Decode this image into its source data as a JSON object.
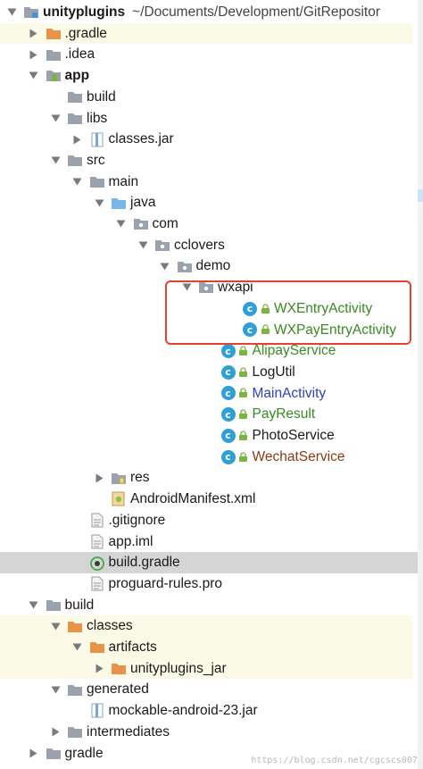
{
  "colors": {
    "green": "#3a8a22",
    "blue": "#2a45b8",
    "brown": "#8a3a14",
    "default": "#1a1a1a",
    "selection": "#d5d5d5",
    "highlight": "#fafae6",
    "redbox": "#e6412f"
  },
  "tree": [
    {
      "depth": 0,
      "arrow": "down",
      "icon": "folder-module-icon",
      "label": "unityplugins",
      "bold": true,
      "hint": "~/Documents/Development/GitRepositor"
    },
    {
      "depth": 1,
      "arrow": "right",
      "icon": "folder-orange-icon",
      "label": ".gradle",
      "hl": true
    },
    {
      "depth": 1,
      "arrow": "right",
      "icon": "folder-gray-icon",
      "label": ".idea"
    },
    {
      "depth": 1,
      "arrow": "down",
      "icon": "folder-app-icon",
      "label": "app",
      "bold": true
    },
    {
      "depth": 2,
      "arrow": "none",
      "icon": "folder-gray-icon",
      "label": "build"
    },
    {
      "depth": 2,
      "arrow": "down",
      "icon": "folder-gray-icon",
      "label": "libs"
    },
    {
      "depth": 3,
      "arrow": "right",
      "icon": "jar-icon",
      "label": "classes.jar"
    },
    {
      "depth": 2,
      "arrow": "down",
      "icon": "folder-gray-icon",
      "label": "src"
    },
    {
      "depth": 3,
      "arrow": "down",
      "icon": "folder-gray-icon",
      "label": "main"
    },
    {
      "depth": 4,
      "arrow": "down",
      "icon": "folder-blue-icon",
      "label": "java"
    },
    {
      "depth": 5,
      "arrow": "down",
      "icon": "package-icon",
      "label": "com"
    },
    {
      "depth": 6,
      "arrow": "down",
      "icon": "package-icon",
      "label": "cclovers"
    },
    {
      "depth": 7,
      "arrow": "down",
      "icon": "package-icon",
      "label": "demo"
    },
    {
      "depth": 8,
      "arrow": "down",
      "icon": "package-icon",
      "label": "wxapi"
    },
    {
      "depth": 10,
      "arrow": "none",
      "icon": "class-icon",
      "label": "WXEntryActivity",
      "color": "green"
    },
    {
      "depth": 10,
      "arrow": "none",
      "icon": "class-icon",
      "label": "WXPayEntryActivity",
      "color": "green"
    },
    {
      "depth": 9,
      "arrow": "none",
      "icon": "class-icon",
      "label": "AlipayService",
      "color": "green"
    },
    {
      "depth": 9,
      "arrow": "none",
      "icon": "class-icon",
      "label": "LogUtil",
      "color": "default"
    },
    {
      "depth": 9,
      "arrow": "none",
      "icon": "class-icon",
      "label": "MainActivity",
      "color": "blue"
    },
    {
      "depth": 9,
      "arrow": "none",
      "icon": "class-icon",
      "label": "PayResult",
      "color": "green"
    },
    {
      "depth": 9,
      "arrow": "none",
      "icon": "class-icon",
      "label": "PhotoService",
      "color": "default"
    },
    {
      "depth": 9,
      "arrow": "none",
      "icon": "class-icon",
      "label": "WechatService",
      "color": "brown"
    },
    {
      "depth": 4,
      "arrow": "right",
      "icon": "folder-res-icon",
      "label": "res"
    },
    {
      "depth": 4,
      "arrow": "none",
      "icon": "manifest-icon",
      "label": "AndroidManifest.xml"
    },
    {
      "depth": 3,
      "arrow": "none",
      "icon": "file-icon",
      "label": ".gitignore"
    },
    {
      "depth": 3,
      "arrow": "none",
      "icon": "file-icon",
      "label": "app.iml"
    },
    {
      "depth": 3,
      "arrow": "none",
      "icon": "gradle-icon",
      "label": "build.gradle",
      "selected": true
    },
    {
      "depth": 3,
      "arrow": "none",
      "icon": "file-icon",
      "label": "proguard-rules.pro"
    },
    {
      "depth": 1,
      "arrow": "down",
      "icon": "folder-gray-icon",
      "label": "build"
    },
    {
      "depth": 2,
      "arrow": "down",
      "icon": "folder-orange-icon",
      "label": "classes",
      "hl": true
    },
    {
      "depth": 3,
      "arrow": "down",
      "icon": "folder-orange-icon",
      "label": "artifacts",
      "hl": true
    },
    {
      "depth": 4,
      "arrow": "right",
      "icon": "folder-orange-icon",
      "label": "unityplugins_jar",
      "hl": true
    },
    {
      "depth": 2,
      "arrow": "down",
      "icon": "folder-gray-icon",
      "label": "generated"
    },
    {
      "depth": 3,
      "arrow": "none",
      "icon": "jar-icon",
      "label": "mockable-android-23.jar"
    },
    {
      "depth": 2,
      "arrow": "right",
      "icon": "folder-gray-icon",
      "label": "intermediates"
    },
    {
      "depth": 1,
      "arrow": "right",
      "icon": "folder-gray-icon",
      "label": "gradle"
    }
  ],
  "watermark": "https://blog.csdn.net/cgcscs007"
}
